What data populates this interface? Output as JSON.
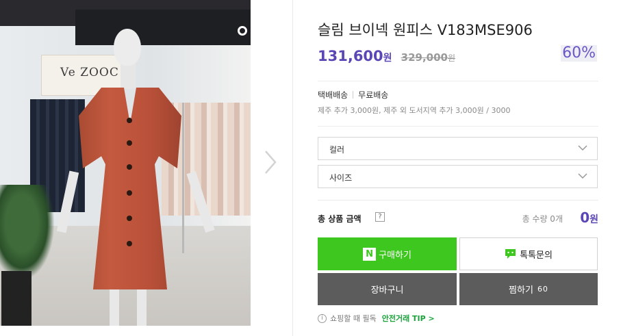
{
  "product": {
    "title": "슬림 브이넥 원피스 V183MSE906",
    "sale_price": "131,600",
    "sale_unit": "원",
    "original_price": "329,000",
    "original_unit": "원",
    "discount": "60%"
  },
  "photo": {
    "logo_text": "Ve ZOOC"
  },
  "shipping": {
    "method": "택배배송",
    "fee": "무료배송",
    "note": "제주 추가 3,000원, 제주 외 도서지역 추가 3,000원 / 3000"
  },
  "options": [
    {
      "label": "컬러"
    },
    {
      "label": "사이즈"
    }
  ],
  "total": {
    "label": "총 상품 금액",
    "help": "?",
    "quantity_text": "총 수량 0개",
    "amount": "0",
    "unit": "원"
  },
  "buttons": {
    "buy_icon": "N",
    "buy": "구매하기",
    "talk": "톡톡문의",
    "cart": "장바구니",
    "wish": "찜하기",
    "wish_count": "60"
  },
  "tip": {
    "icon": "i",
    "text": "쇼핑할 때 필독",
    "link": "안전거래 TIP >"
  },
  "colors": {
    "accent": "#5b46b5",
    "buy_green": "#3ec71e",
    "dark_button": "#5c5c5c"
  }
}
